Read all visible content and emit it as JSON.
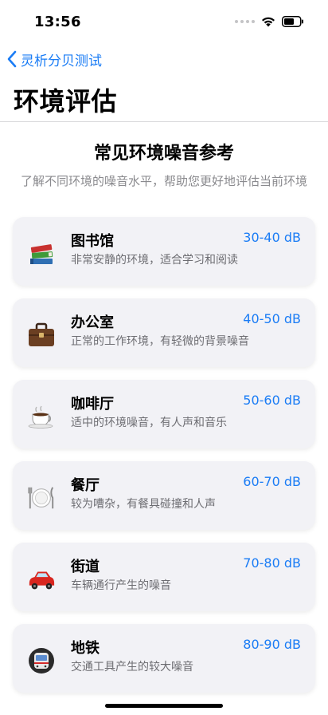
{
  "status_bar": {
    "time": "13:56"
  },
  "nav": {
    "back_label": "灵析分贝测试"
  },
  "page": {
    "title": "环境评估"
  },
  "section": {
    "title": "常见环境噪音参考",
    "subtitle": "了解不同环境的噪音水平，帮助您更好地评估当前环境"
  },
  "colors": {
    "accent": "#1a7cf5",
    "card_bg": "#f2f2f6"
  },
  "environments": [
    {
      "name": "图书馆",
      "description": "非常安静的环境，适合学习和阅读",
      "range": "30-40 dB",
      "icon": "books-icon"
    },
    {
      "name": "办公室",
      "description": "正常的工作环境，有轻微的背景噪音",
      "range": "40-50 dB",
      "icon": "briefcase-icon"
    },
    {
      "name": "咖啡厅",
      "description": "适中的环境噪音，有人声和音乐",
      "range": "50-60 dB",
      "icon": "coffee-icon"
    },
    {
      "name": "餐厅",
      "description": "较为嘈杂，有餐具碰撞和人声",
      "range": "60-70 dB",
      "icon": "plate-icon"
    },
    {
      "name": "街道",
      "description": "车辆通行产生的噪音",
      "range": "70-80 dB",
      "icon": "car-icon"
    },
    {
      "name": "地铁",
      "description": "交通工具产生的较大噪音",
      "range": "80-90 dB",
      "icon": "metro-icon"
    }
  ]
}
